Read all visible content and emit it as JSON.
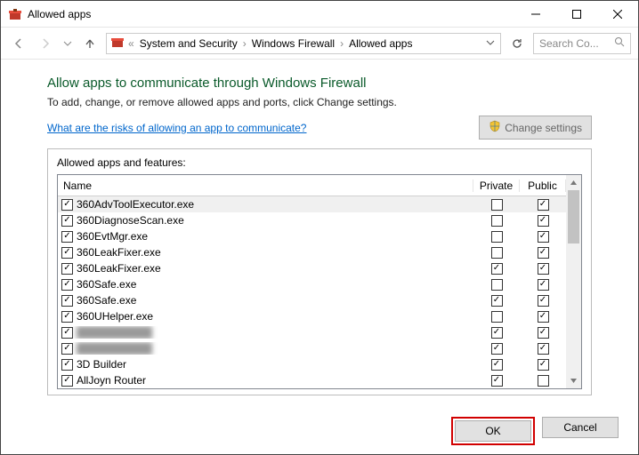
{
  "window": {
    "title": "Allowed apps"
  },
  "breadcrumbs": [
    "System and Security",
    "Windows Firewall",
    "Allowed apps"
  ],
  "search": {
    "placeholder": "Search Co..."
  },
  "page": {
    "heading": "Allow apps to communicate through Windows Firewall",
    "subheading": "To add, change, or remove allowed apps and ports, click Change settings.",
    "risks_link": "What are the risks of allowing an app to communicate?",
    "change_settings": "Change settings",
    "group_title": "Allowed apps and features:"
  },
  "columns": {
    "name": "Name",
    "private": "Private",
    "public": "Public"
  },
  "rows": [
    {
      "enabled": true,
      "name": "360AdvToolExecutor.exe",
      "private": false,
      "public": true,
      "selected": true
    },
    {
      "enabled": true,
      "name": "360DiagnoseScan.exe",
      "private": false,
      "public": true
    },
    {
      "enabled": true,
      "name": "360EvtMgr.exe",
      "private": false,
      "public": true
    },
    {
      "enabled": true,
      "name": "360LeakFixer.exe",
      "private": false,
      "public": true
    },
    {
      "enabled": true,
      "name": "360LeakFixer.exe",
      "private": true,
      "public": true
    },
    {
      "enabled": true,
      "name": "360Safe.exe",
      "private": false,
      "public": true
    },
    {
      "enabled": true,
      "name": "360Safe.exe",
      "private": true,
      "public": true
    },
    {
      "enabled": true,
      "name": "360UHelper.exe",
      "private": false,
      "public": true
    },
    {
      "enabled": true,
      "name": "██████████",
      "private": true,
      "public": true,
      "blur": true
    },
    {
      "enabled": true,
      "name": "██████████",
      "private": true,
      "public": true,
      "blur": true
    },
    {
      "enabled": true,
      "name": "3D Builder",
      "private": true,
      "public": true
    },
    {
      "enabled": true,
      "name": "AllJoyn Router",
      "private": true,
      "public": false
    }
  ],
  "buttons": {
    "ok": "OK",
    "cancel": "Cancel"
  }
}
